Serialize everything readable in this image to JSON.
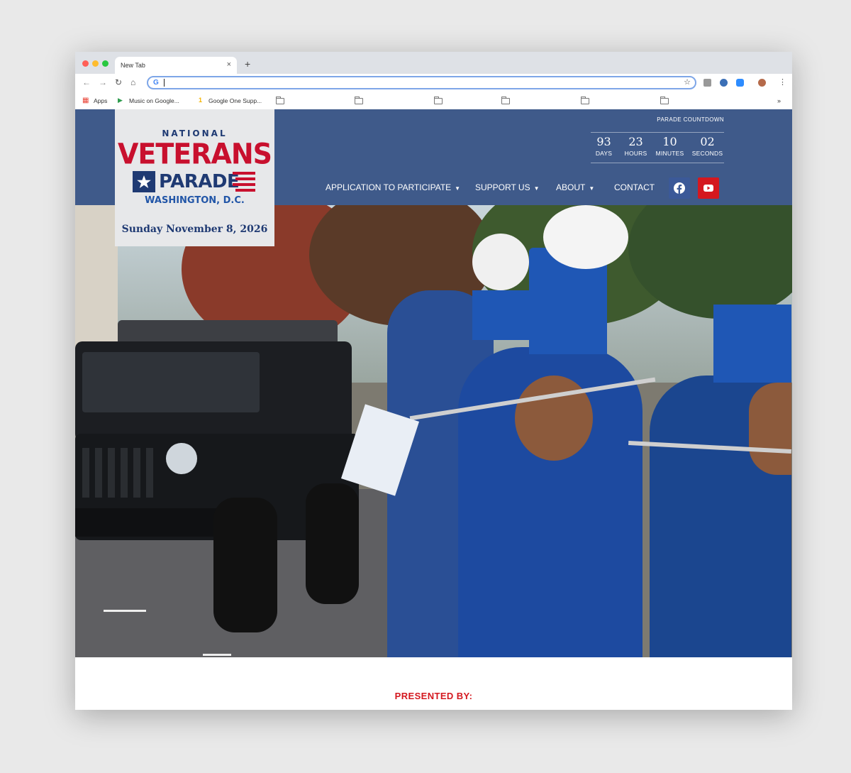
{
  "browser": {
    "tab_title": "New Tab",
    "new_tab_symbol": "+",
    "close_symbol": "×",
    "address_value": "",
    "bookmarks": [
      "Apps",
      "Music on Google...",
      "Google One Supp..."
    ],
    "bookmarks_overflow": "»",
    "colors": {
      "close": "#ff5f57",
      "minimize": "#febc2e",
      "maximize": "#28c840",
      "address_focus": "#7ea6e8"
    }
  },
  "site": {
    "logo": {
      "national": "NATIONAL",
      "veterans": "VETERANS",
      "parade": "PARADE",
      "location": "WASHINGTON, D.C.",
      "date": "Sunday November 8, 2026"
    },
    "countdown": {
      "title": "PARADE COUNTDOWN",
      "units": [
        {
          "value": "93",
          "label": "DAYS"
        },
        {
          "value": "23",
          "label": "HOURS"
        },
        {
          "value": "10",
          "label": "MINUTES"
        },
        {
          "value": "02",
          "label": "SECONDS"
        }
      ]
    },
    "nav": [
      {
        "label": "APPLICATION TO PARTICIPATE",
        "dropdown": true
      },
      {
        "label": "SUPPORT US",
        "dropdown": true
      },
      {
        "label": "ABOUT",
        "dropdown": true
      },
      {
        "label": "CONTACT",
        "dropdown": false
      }
    ],
    "social": [
      {
        "name": "facebook-icon",
        "color": "#3b5998"
      },
      {
        "name": "youtube-icon",
        "color": "#d4181f"
      }
    ],
    "presented_by": "PRESENTED BY:",
    "colors": {
      "header": "#3f5a8a",
      "brand_red": "#c8102e",
      "brand_navy": "#1f3a73"
    }
  }
}
